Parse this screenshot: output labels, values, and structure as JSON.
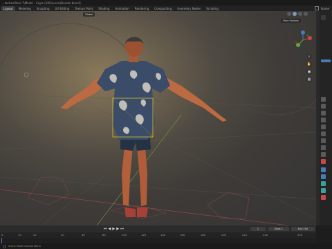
{
  "window": {
    "title": "...taches\\Pack 7\\Model - Coyle (28\\Source\\Blender.blend]"
  },
  "workspaces": [
    "Layout",
    "Modeling",
    "Sculpting",
    "UV Editing",
    "Texture Paint",
    "Shading",
    "Animation",
    "Rendering",
    "Compositing",
    "Geometry Nodes",
    "Scripting"
  ],
  "active_workspace": "Layout",
  "scene_label": "Scene",
  "viewport": {
    "header_buttons": [
      "Global"
    ],
    "pose_options": "Pose Options"
  },
  "timeline": {
    "current_frame": "1",
    "start_label": "Start",
    "start_value": "1",
    "end_label": "End",
    "end_value": "250",
    "ruler_ticks": [
      "0",
      "10",
      "20",
      "40",
      "60",
      "80",
      "100",
      "120",
      "140",
      "160",
      "180",
      "200",
      "220",
      "240",
      "250"
    ]
  },
  "statusbar": {
    "text": "Scene Mode Context Menu"
  },
  "colors": {
    "accent": "#4a7ab8",
    "selection": "#d4c22a",
    "active_frame": "#4a7ab8"
  },
  "icons": [
    "camera-icon",
    "grab-icon",
    "zoom-icon",
    "hand-icon",
    "play-icon",
    "jump-start-icon",
    "jump-end-icon"
  ]
}
